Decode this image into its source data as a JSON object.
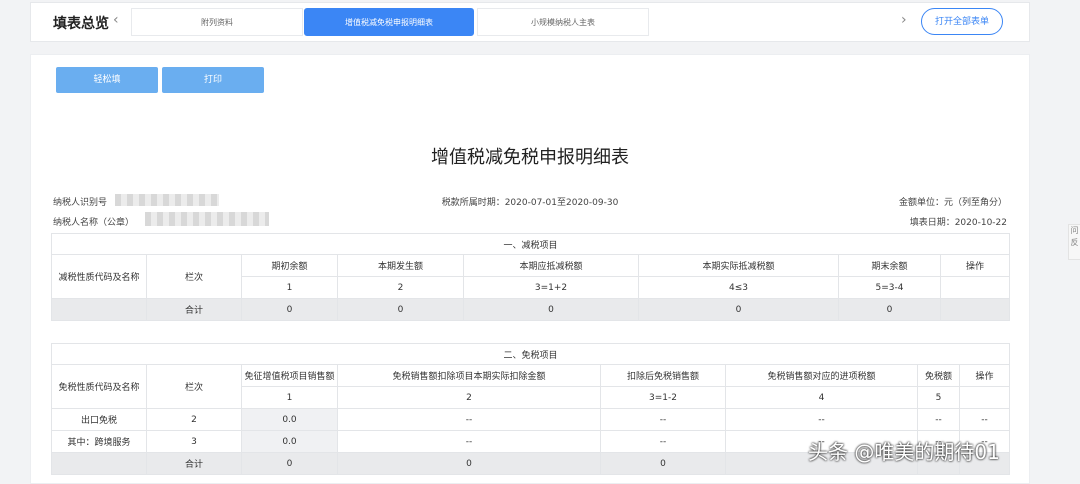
{
  "header": {
    "title": "填表总览",
    "tabs": [
      {
        "label": "附列资料"
      },
      {
        "label": "增值税减免税申报明细表"
      },
      {
        "label": "小规模纳税人主表"
      }
    ],
    "open_all": "打开全部表单"
  },
  "toolbar": {
    "easy_fill": "轻松填",
    "print": "打印"
  },
  "doc": {
    "title": "增值税减免税申报明细表",
    "taxpayer_id_label": "纳税人识别号",
    "taxpayer_name_label": "纳税人名称（公章）",
    "period": "税款所属时期：2020-07-01至2020-09-30",
    "unit": "金额单位：元（列至角分）",
    "fill_date": "填表日期：2020-10-22"
  },
  "section1": {
    "title": "一、减税项目",
    "col_name": "减税性质代码及名称",
    "col_row": "栏次",
    "headers": [
      "期初余额",
      "本期发生额",
      "本期应抵减税额",
      "本期实际抵减税额",
      "期末余额",
      "操作"
    ],
    "numbers": [
      "1",
      "2",
      "3=1+2",
      "4≤3",
      "5=3-4",
      ""
    ],
    "total": {
      "label": "合计",
      "values": [
        "0",
        "0",
        "0",
        "0",
        "0",
        ""
      ]
    }
  },
  "section2": {
    "title": "二、免税项目",
    "col_name": "免税性质代码及名称",
    "col_row": "栏次",
    "headers": [
      "免征增值税项目销售额",
      "免税销售额扣除项目本期实际扣除金额",
      "扣除后免税销售额",
      "免税销售额对应的进项税额",
      "免税额",
      "操作"
    ],
    "numbers": [
      "1",
      "2",
      "3=1-2",
      "4",
      "5",
      ""
    ],
    "rows": [
      {
        "name": "出口免税",
        "row": "2",
        "values": [
          "0.0",
          "--",
          "--",
          "--",
          "--",
          "--"
        ]
      },
      {
        "name": "其中：跨境服务",
        "row": "3",
        "values": [
          "0.0",
          "--",
          "--",
          "--",
          "--",
          "--"
        ]
      }
    ],
    "total": {
      "label": "合计",
      "values": [
        "0",
        "0",
        "0",
        "",
        "",
        ""
      ]
    }
  },
  "side_tab": "问反",
  "watermark": "头条 @唯美的期待01"
}
